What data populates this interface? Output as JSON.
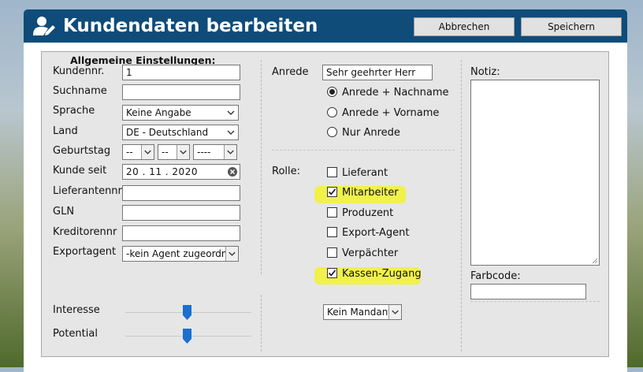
{
  "colors": {
    "header": "#0f4c79",
    "panel": "#e6e6e6",
    "highlight": "#f2f23a",
    "slider_thumb": "#1a6fd0"
  },
  "header": {
    "icon": "user-edit-icon",
    "title": "Kundendaten bearbeiten",
    "cancel_label": "Abbrechen",
    "save_label": "Speichern"
  },
  "general": {
    "legend": "Allgemeine Einstellungen:",
    "customer_no": {
      "label": "Kundennr.",
      "value": "1"
    },
    "search_name": {
      "label": "Suchname",
      "value": ""
    },
    "language": {
      "label": "Sprache",
      "value": "Keine Angabe"
    },
    "country": {
      "label": "Land",
      "value": "DE - Deutschland"
    },
    "birthday": {
      "label": "Geburtstag",
      "day": "--",
      "month": "--",
      "year": "----"
    },
    "customer_since": {
      "label": "Kunde seit",
      "value": "20 . 11 . 2020"
    },
    "supplier_no": {
      "label": "Lieferantennr",
      "value": ""
    },
    "gln": {
      "label": "GLN",
      "value": ""
    },
    "creditor_no": {
      "label": "Kreditorennr",
      "value": ""
    },
    "export_agent": {
      "label": "Exportagent",
      "value": "-kein Agent zugeordnet-"
    }
  },
  "salutation": {
    "label": "Anrede",
    "value": "Sehr geehrter Herr",
    "options": [
      {
        "label": "Anrede + Nachname",
        "selected": true
      },
      {
        "label": "Anrede + Vorname",
        "selected": false
      },
      {
        "label": "Nur Anrede",
        "selected": false
      }
    ]
  },
  "roles": {
    "label": "Rolle:",
    "items": [
      {
        "label": "Lieferant",
        "checked": false,
        "highlighted": false
      },
      {
        "label": "Mitarbeiter",
        "checked": true,
        "highlighted": true
      },
      {
        "label": "Produzent",
        "checked": false,
        "highlighted": false
      },
      {
        "label": "Export-Agent",
        "checked": false,
        "highlighted": false
      },
      {
        "label": "Verpächter",
        "checked": false,
        "highlighted": false
      },
      {
        "label": "Kassen-Zugang",
        "checked": true,
        "highlighted": true
      }
    ]
  },
  "notes": {
    "label": "Notiz:",
    "value": ""
  },
  "color_code": {
    "label": "Farbcode:",
    "value": ""
  },
  "sliders": {
    "interest": {
      "label": "Interesse",
      "value_fraction": 0.5
    },
    "potential": {
      "label": "Potential",
      "value_fraction": 0.5
    }
  },
  "mandant": {
    "value": "Kein Mandant"
  }
}
